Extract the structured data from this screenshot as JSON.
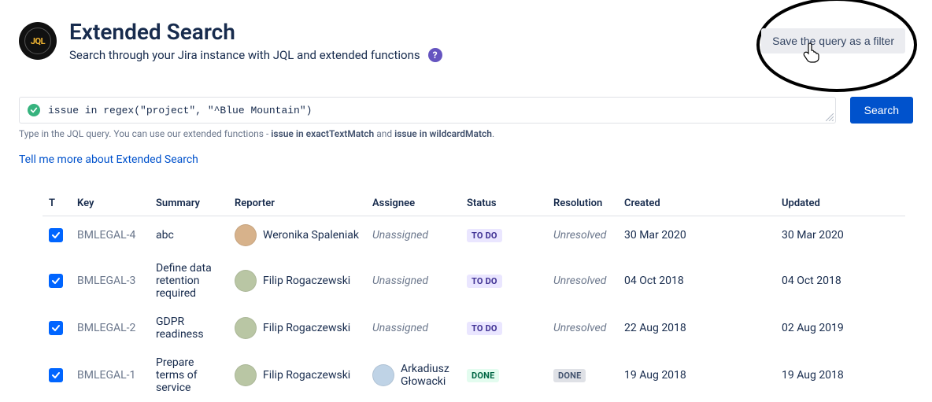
{
  "header": {
    "logo_text": "JQL",
    "title": "Extended Search",
    "subtitle": "Search through your Jira instance with JQL and extended functions",
    "save_filter_label": "Save the query as a filter"
  },
  "search": {
    "query_value": "issue in regex(\"project\", \"^Blue Mountain\")",
    "button_label": "Search",
    "hint_prefix": "Type in the JQL query. You can use our extended functions - ",
    "hint_fn1": "issue in exactTextMatch",
    "hint_mid": " and ",
    "hint_fn2": "issue in wildcardMatch",
    "hint_suffix": "."
  },
  "learn_more": {
    "label": "Tell me more about Extended Search"
  },
  "table": {
    "columns": {
      "t": "T",
      "key": "Key",
      "summary": "Summary",
      "reporter": "Reporter",
      "assignee": "Assignee",
      "status": "Status",
      "resolution": "Resolution",
      "created": "Created",
      "updated": "Updated"
    },
    "rows": [
      {
        "key": "BMLEGAL-4",
        "summary": "abc",
        "reporter": "Weronika Spaleniak",
        "reporter_avatar_bg": "#D7B28B",
        "assignee": "Unassigned",
        "assignee_unassigned": true,
        "assignee_avatar_bg": "",
        "status_label": "TO DO",
        "status_style": "todo",
        "resolution": "Unresolved",
        "resolution_style": "text",
        "created": "30 Mar 2020",
        "updated": "30 Mar 2020"
      },
      {
        "key": "BMLEGAL-3",
        "summary": "Define data retention required",
        "reporter": "Filip Rogaczewski",
        "reporter_avatar_bg": "#B9C6A4",
        "assignee": "Unassigned",
        "assignee_unassigned": true,
        "assignee_avatar_bg": "",
        "status_label": "TO DO",
        "status_style": "todo",
        "resolution": "Unresolved",
        "resolution_style": "text",
        "created": "04 Oct 2018",
        "updated": "04 Oct 2018"
      },
      {
        "key": "BMLEGAL-2",
        "summary": "GDPR readiness",
        "reporter": "Filip Rogaczewski",
        "reporter_avatar_bg": "#B9C6A4",
        "assignee": "Unassigned",
        "assignee_unassigned": true,
        "assignee_avatar_bg": "",
        "status_label": "TO DO",
        "status_style": "todo",
        "resolution": "Unresolved",
        "resolution_style": "text",
        "created": "22 Aug 2018",
        "updated": "02 Aug 2019"
      },
      {
        "key": "BMLEGAL-1",
        "summary": "Prepare terms of service",
        "reporter": "Filip Rogaczewski",
        "reporter_avatar_bg": "#B9C6A4",
        "assignee": "Arkadiusz Głowacki",
        "assignee_unassigned": false,
        "assignee_avatar_bg": "#BFD3E6",
        "status_label": "DONE",
        "status_style": "done-green",
        "resolution": "DONE",
        "resolution_style": "done-grey",
        "created": "19 Aug 2018",
        "updated": "19 Aug 2018"
      }
    ]
  }
}
